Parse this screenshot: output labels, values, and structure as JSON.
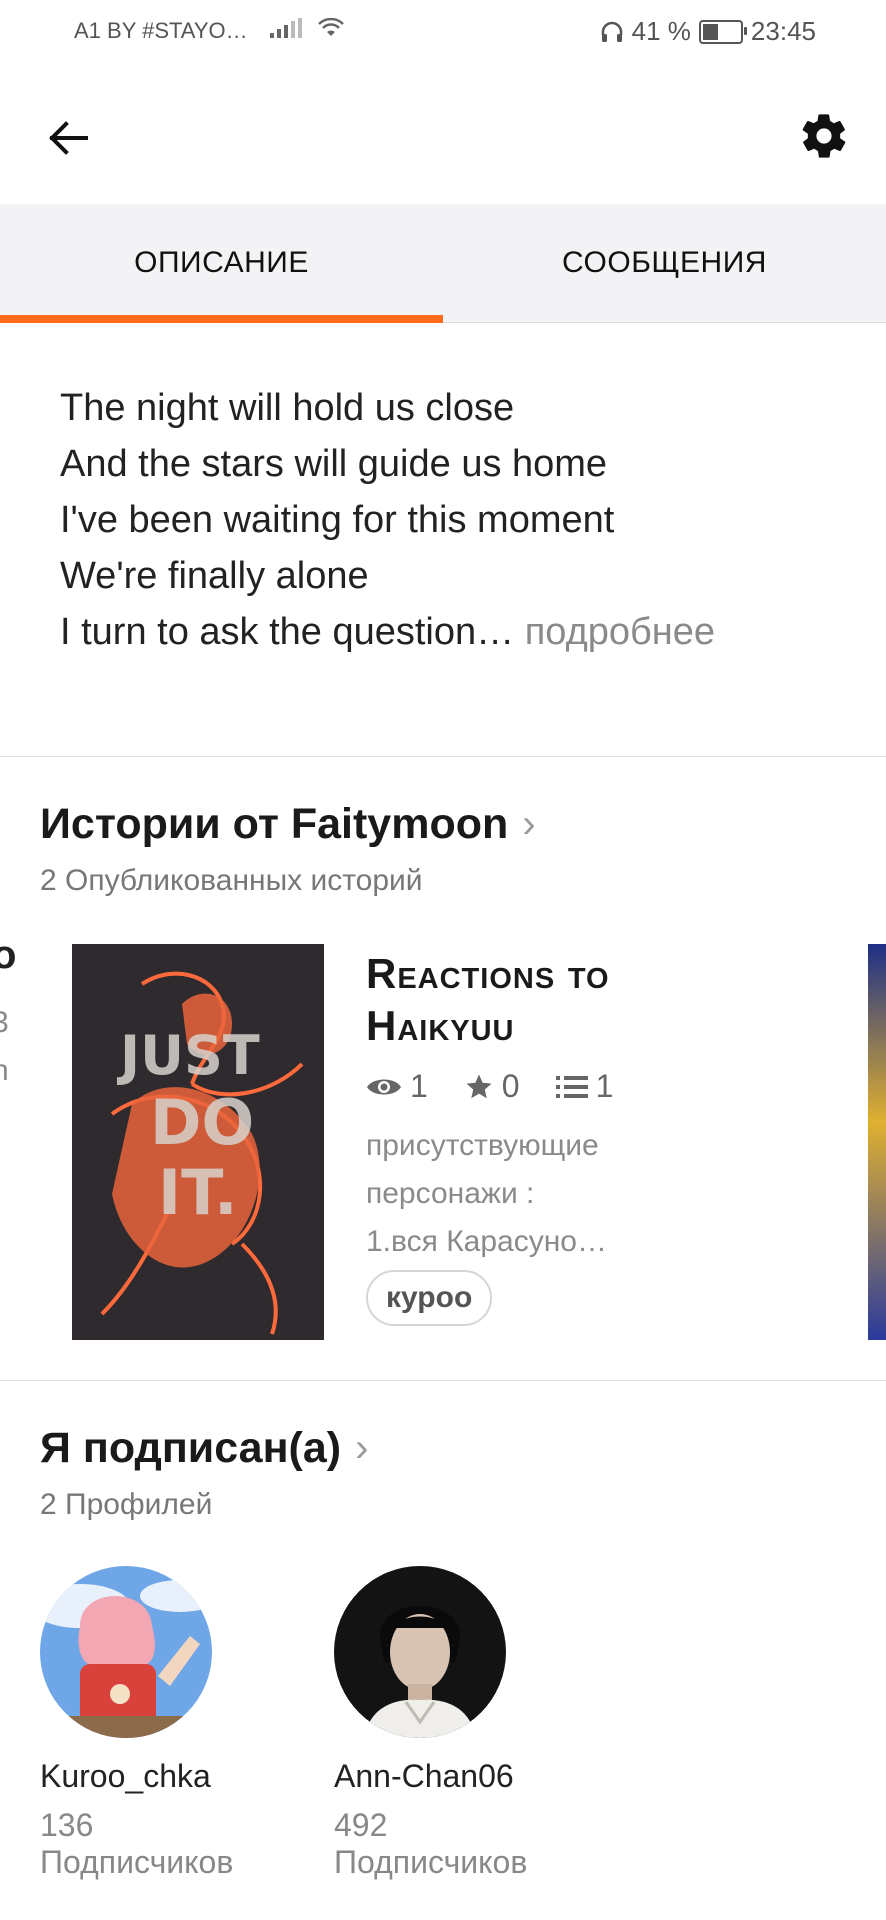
{
  "status_bar": {
    "carrier": "A1 BY #STAYO…",
    "battery_percent": "41 %",
    "time": "23:45",
    "battery_level": 0.41
  },
  "toolbar": {
    "back_icon": "arrow-left",
    "settings_icon": "gear"
  },
  "tabs": [
    {
      "label": "ОПИСАНИЕ",
      "active": true
    },
    {
      "label": "СООБЩЕНИЯ",
      "active": false
    }
  ],
  "accent_color": "#ff6b1a",
  "description": {
    "lines": [
      "The night will hold us close",
      "And the stars will guide us home",
      "I've been waiting for this moment",
      "We're finally alone",
      "I turn to ask the question…"
    ],
    "more_label": "подробнее"
  },
  "stories_section": {
    "title": "Истории от Faitymoon",
    "subtitle": "2 Опубликованных историй",
    "story": {
      "title_line1": "Reactions to",
      "title_line2": "Haikyuu",
      "views": "1",
      "votes": "0",
      "parts": "1",
      "desc_lines": [
        "присутствующие",
        "персонажи :",
        "1.вся Карасуно…"
      ],
      "tag": "куроо",
      "cover_text": [
        "JUST",
        "DO",
        "IT."
      ]
    }
  },
  "following_section": {
    "title": "Я подписан(а)",
    "subtitle": "2 Профилей",
    "profiles": [
      {
        "name": "Kuroo_chka",
        "count": "136",
        "label": "Подписчиков"
      },
      {
        "name": "Ann-Chan06",
        "count": "492",
        "label": "Подписчиков"
      }
    ]
  }
}
